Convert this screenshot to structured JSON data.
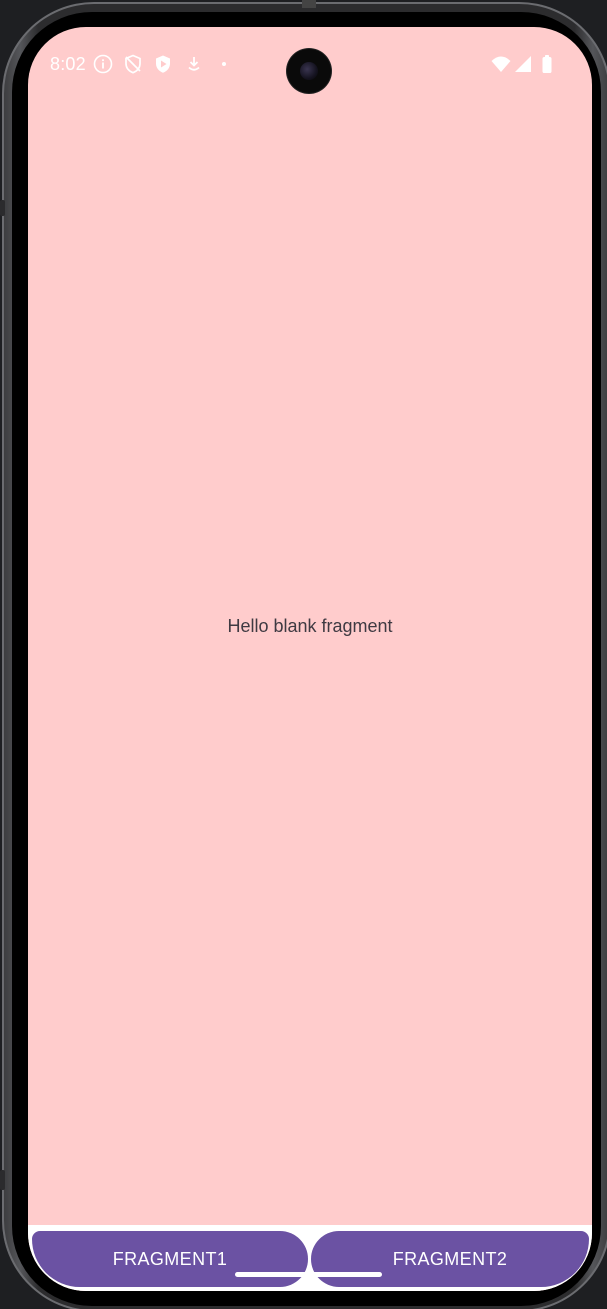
{
  "status_bar": {
    "time": "8:02",
    "left_icons": [
      "info-icon",
      "shield-off-icon",
      "play-shield-icon",
      "download-icon",
      "dot-icon"
    ],
    "right_icons": [
      "wifi-icon",
      "signal-icon",
      "battery-icon"
    ]
  },
  "content": {
    "message": "Hello blank fragment",
    "background_color": "#ffcccc"
  },
  "buttons": {
    "fragment1_label": "FRAGMENT1",
    "fragment2_label": "FRAGMENT2",
    "color": "#6b52a3"
  }
}
